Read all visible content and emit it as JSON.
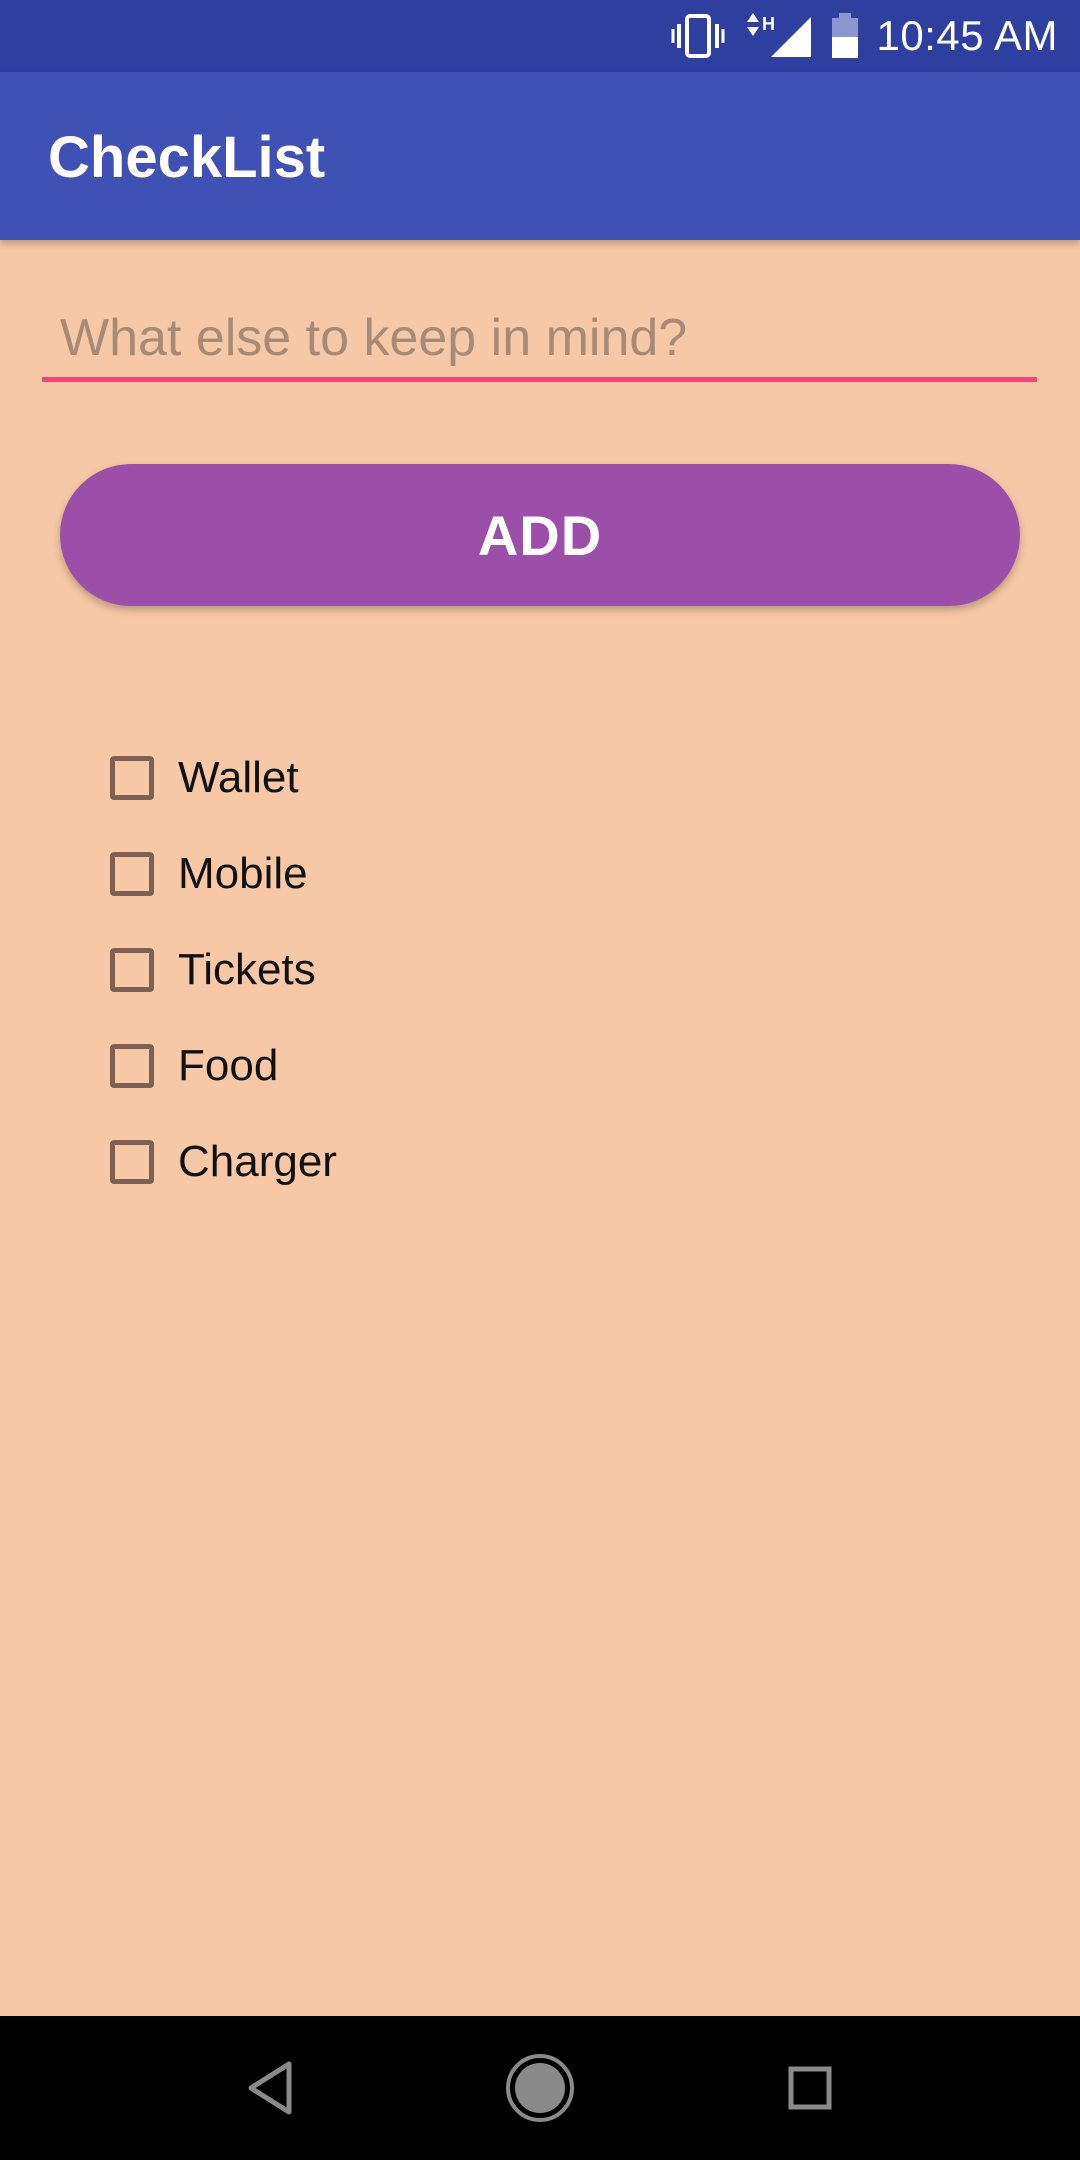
{
  "status_bar": {
    "time": "10:45 AM",
    "network_label": "H",
    "icons": [
      "vibrate-icon",
      "signal-icon",
      "battery-icon"
    ]
  },
  "app_bar": {
    "title": "CheckList"
  },
  "input": {
    "placeholder": "What else to keep in mind?",
    "value": ""
  },
  "add_button": {
    "label": "ADD"
  },
  "checklist": {
    "items": [
      {
        "label": "Wallet",
        "checked": false
      },
      {
        "label": "Mobile",
        "checked": false
      },
      {
        "label": "Tickets",
        "checked": false
      },
      {
        "label": "Food",
        "checked": false
      },
      {
        "label": "Charger",
        "checked": false
      }
    ]
  },
  "nav_bar": {
    "icons": [
      "back-icon",
      "home-icon",
      "recents-icon"
    ]
  },
  "colors": {
    "status_bar": "#2e3f9f",
    "app_bar": "#3f51b5",
    "background": "#f7c8a5",
    "accent": "#f2457a",
    "button": "#9b4fa8",
    "checkbox_border": "#7d6150"
  }
}
